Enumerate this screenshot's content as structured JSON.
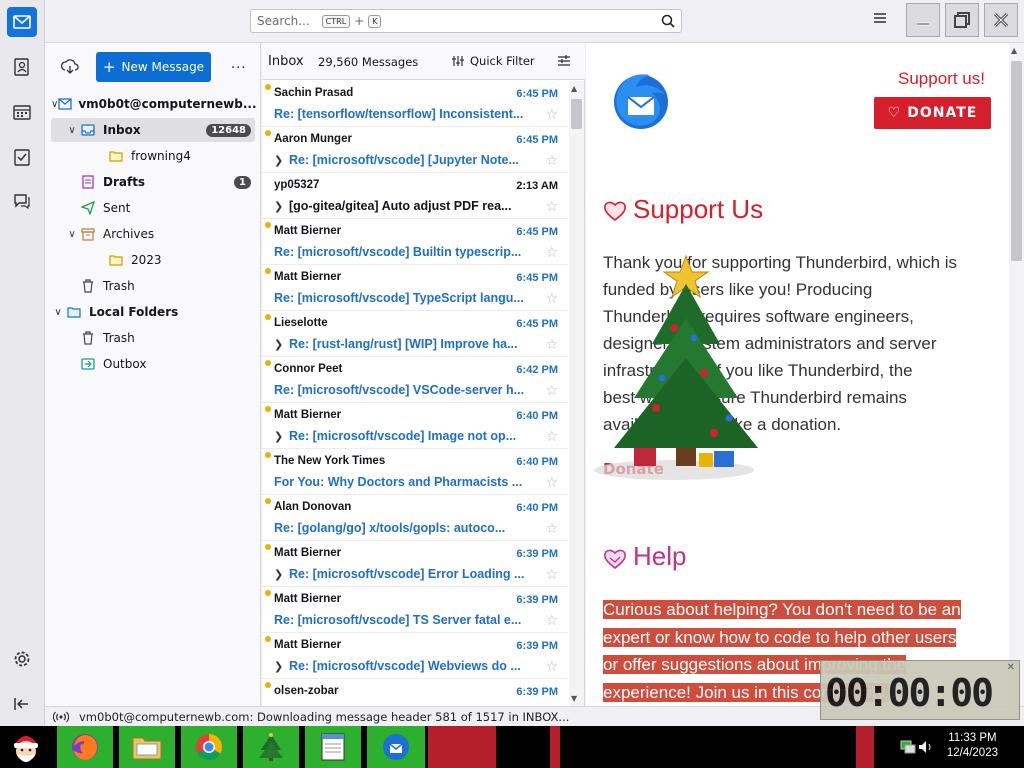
{
  "app": {
    "search_placeholder": "Search...",
    "search_key1": "CTRL",
    "search_plus": "+",
    "search_key2": "K"
  },
  "folders": {
    "new_message": "New Message",
    "more": "...",
    "account": "vm0b0t@computernewb...",
    "items": [
      {
        "label": "Inbox",
        "count": "12648"
      },
      {
        "label": "frowning4"
      },
      {
        "label": "Drafts",
        "count": "1"
      },
      {
        "label": "Sent"
      },
      {
        "label": "Archives"
      },
      {
        "label": "2023"
      },
      {
        "label": "Trash"
      },
      {
        "label": "Local Folders"
      },
      {
        "label": "Trash"
      },
      {
        "label": "Outbox"
      }
    ]
  },
  "list": {
    "folder": "Inbox",
    "count": "29,560 Messages",
    "quick_filter": "Quick Filter",
    "messages": [
      {
        "from": "Sachin Prasad",
        "time": "6:45 PM",
        "subject": "Re: [tensorflow/tensorflow] Inconsistent...",
        "unread": true,
        "thread": false
      },
      {
        "from": "Aaron Munger",
        "time": "6:45 PM",
        "subject": "Re: [microsoft/vscode] [Jupyter Note...",
        "unread": true,
        "thread": true
      },
      {
        "from": "yp05327",
        "time": "2:13 AM",
        "subject": "[go-gitea/gitea] Auto adjust PDF rea...",
        "unread": false,
        "thread": true
      },
      {
        "from": "Matt Bierner",
        "time": "6:45 PM",
        "subject": "Re: [microsoft/vscode] Builtin typescrip...",
        "unread": true,
        "thread": false
      },
      {
        "from": "Matt Bierner",
        "time": "6:45 PM",
        "subject": "Re: [microsoft/vscode] TypeScript langu...",
        "unread": true,
        "thread": false
      },
      {
        "from": "Lieselotte",
        "time": "6:45 PM",
        "subject": "Re: [rust-lang/rust] [WIP] Improve ha...",
        "unread": true,
        "thread": true
      },
      {
        "from": "Connor Peet",
        "time": "6:42 PM",
        "subject": "Re: [microsoft/vscode] VSCode-server h...",
        "unread": true,
        "thread": false
      },
      {
        "from": "Matt Bierner",
        "time": "6:40 PM",
        "subject": "Re: [microsoft/vscode] Image not op...",
        "unread": true,
        "thread": true
      },
      {
        "from": "The New York Times",
        "time": "6:40 PM",
        "subject": "For You: Why Doctors and Pharmacists ...",
        "unread": true,
        "thread": false
      },
      {
        "from": "Alan Donovan",
        "time": "6:40 PM",
        "subject": "Re: [golang/go] x/tools/gopls: autoco...",
        "unread": true,
        "thread": false
      },
      {
        "from": "Matt Bierner",
        "time": "6:39 PM",
        "subject": "Re: [microsoft/vscode] Error Loading ...",
        "unread": true,
        "thread": true
      },
      {
        "from": "Matt Bierner",
        "time": "6:39 PM",
        "subject": "Re: [microsoft/vscode] TS Server fatal e...",
        "unread": true,
        "thread": false
      },
      {
        "from": "Matt Bierner",
        "time": "6:39 PM",
        "subject": "Re: [microsoft/vscode] Webviews do ...",
        "unread": true,
        "thread": true
      },
      {
        "from": "olsen-zobar",
        "time": "6:39 PM",
        "subject": "",
        "unread": true,
        "thread": false
      }
    ]
  },
  "reader": {
    "support_link": "Support us!",
    "donate_button": "DONATE",
    "support_heading": "Support Us",
    "support_text_1": "Thank you for supporting Thunderbird, which is",
    "support_text_2": "funded by users like you! Producing",
    "support_text_3": "Thunderbird requires software engineers,",
    "support_text_4": "designers, system administrators and server",
    "support_text_5": "infrastructure. If you like Thunderbird, the",
    "support_text_6": "best way to ensure Thunderbird remains",
    "support_text_7": "available is to make a donation.",
    "donate_link": "Donate",
    "help_heading": "Help",
    "help_line_1": "Curious about helping? You don't need to be an",
    "help_line_2": "expert or know how to code to help other users",
    "help_line_3": "or offer suggestions about improving the",
    "help_line_4": "experience! Join us in this community."
  },
  "status": {
    "text": "vm0b0t@computernewb.com: Downloading message header 581 of 1517 in INBOX..."
  },
  "timer": {
    "value": "00:00:00"
  },
  "taskbar": {
    "time": "11:33 PM",
    "date": "12/4/2023"
  },
  "colors": {
    "accent": "#0c6ed5",
    "donate": "#d51f2c",
    "help": "#c1328a",
    "unread_dot": "#e8b400",
    "link": "#1f6fc5"
  }
}
